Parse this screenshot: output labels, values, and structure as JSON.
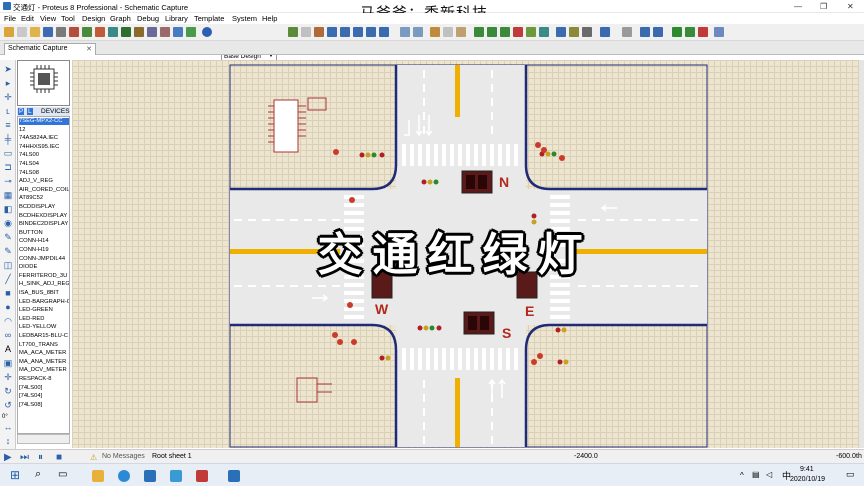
{
  "window": {
    "title": "交通灯 - Proteus 8 Professional - Schematic Capture",
    "overlay_text": "马爸爸：秀新科技",
    "controls": [
      "—",
      "❐",
      "✕"
    ]
  },
  "menu": [
    "File",
    "Edit",
    "View",
    "Tool",
    "Design",
    "Graph",
    "Debug",
    "Library",
    "Template",
    "System",
    "Help"
  ],
  "toolbar": {
    "base_design": "Base Design"
  },
  "tabs": [
    {
      "label": "Schematic Capture",
      "close": "✕"
    }
  ],
  "device_panel": {
    "mode_p": "P",
    "mode_l": "L",
    "header": "DEVICES",
    "items": [
      "7SEG-MPX2-CC",
      "12",
      "74AS824A.IEC",
      "74HHXS95.IEC",
      "74LS00",
      "74LS04",
      "74LS08",
      "ADJ_V_REG",
      "AIR_CORED_COIL",
      "AT89C52",
      "BCDDISPLAY",
      "BCDHEXDISPLAY",
      "BINDEC2DISPLAY",
      "BUTTON",
      "CONN-H14",
      "CONN-H19",
      "CONN-JMPDIL44",
      "DIODE",
      "FERRITEROD_3U",
      "H_SINK_ADJ_REG",
      "ISA_BUS_8BIT",
      "LED-BARGRAPH-G",
      "LED-GREEN",
      "LED-RED",
      "LED-YELLOW",
      "LEDBAR15-BLU-C",
      "LT700_TRANS",
      "MA_ACA_METER",
      "MA_ANA_METER",
      "MA_DCV_METER",
      "RESPACK-8",
      "[74LS00]",
      "[74LS04]",
      "[74LS08]"
    ],
    "selected_index": 0
  },
  "left_angle": "0°",
  "schematic": {
    "directions": {
      "north": "N",
      "south": "S",
      "west": "W",
      "east": "E"
    },
    "overlay_title": "交通红绿灯"
  },
  "status": {
    "messages": "No Messages",
    "sheet": "Root sheet 1",
    "coord_x": "-2400.0",
    "coord_y": "-600.0",
    "unit": "th"
  },
  "taskbar": {
    "time": "9:41",
    "date": "2020/10/19",
    "ime": "中"
  },
  "colors": {
    "road": "#1f2a78",
    "crosswalk": "#ffffff",
    "center_line": "#f0b000",
    "canvas_bg": "#ede5cf",
    "direction_label": "#b22a1e"
  }
}
